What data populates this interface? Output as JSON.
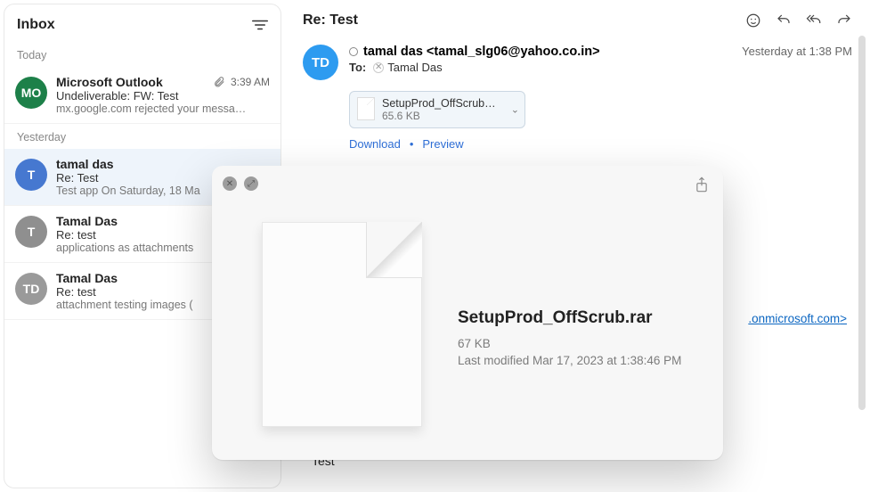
{
  "sidebar": {
    "title": "Inbox",
    "groups": [
      {
        "label": "Today",
        "items": [
          {
            "avatar_text": "MO",
            "avatar_color": "#1d8049",
            "sender": "Microsoft Outlook",
            "subject": "Undeliverable: FW: Test",
            "preview": "mx.google.com rejected your messa…",
            "time_text": "3:39 AM",
            "has_attachment": true,
            "selected": false
          }
        ]
      },
      {
        "label": "Yesterday",
        "items": [
          {
            "avatar_text": "T",
            "avatar_color": "#4678d0",
            "sender": "tamal das",
            "subject": "Re: Test",
            "preview": "Test app On Saturday, 18 Ma",
            "time_text": "",
            "has_attachment": false,
            "selected": true
          },
          {
            "avatar_text": "T",
            "avatar_color": "#8f8f8f",
            "sender": "Tamal Das",
            "subject": "Re: test",
            "preview": "applications as attachments",
            "time_text": "",
            "has_attachment": false,
            "selected": false
          },
          {
            "avatar_text": "TD",
            "avatar_color": "#9a9a9a",
            "sender": "Tamal Das",
            "subject": "Re: test",
            "preview": "attachment testing images (",
            "time_text": "",
            "has_attachment": false,
            "selected": false
          }
        ]
      }
    ]
  },
  "message": {
    "subject": "Re: Test",
    "from_display": "tamal das <tamal_slg06@yahoo.co.in>",
    "to_label": "To:",
    "to_name": "Tamal Das",
    "timestamp": "Yesterday at 1:38 PM",
    "attachment": {
      "name": "SetupProd_OffScrub…",
      "size": "65.6 KB",
      "download_label": "Download",
      "preview_label": "Preview"
    },
    "body_link_text": ".onmicrosoft.com",
    "body_text": "Test"
  },
  "quicklook": {
    "filename": "SetupProd_OffScrub.rar",
    "size": "67 KB",
    "modified": "Last modified Mar 17, 2023 at 1:38:46 PM"
  }
}
